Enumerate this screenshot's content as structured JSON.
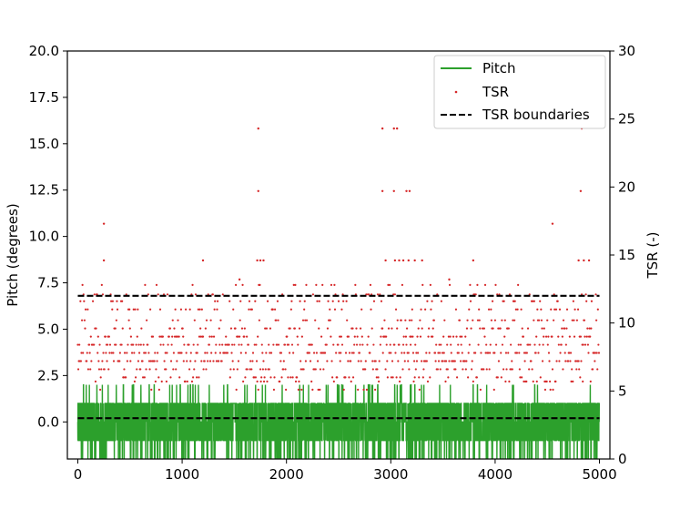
{
  "chart_data": {
    "type": "line",
    "title": "",
    "xlabel": "",
    "ylabel_left": "Pitch (degrees)",
    "ylabel_right": "TSR (-)",
    "xlim": [
      -100,
      5100
    ],
    "ylim_left": [
      -2,
      20
    ],
    "ylim_right": [
      0,
      30
    ],
    "x_ticks": [
      0,
      1000,
      2000,
      3000,
      4000,
      5000
    ],
    "x_tick_labels": [
      "0",
      "1000",
      "2000",
      "3000",
      "4000",
      "5000"
    ],
    "y_left_ticks": [
      0,
      2.5,
      5,
      7.5,
      10,
      12.5,
      15,
      17.5,
      20
    ],
    "y_left_tick_labels": [
      "0.0",
      "2.5",
      "5.0",
      "7.5",
      "10.0",
      "12.5",
      "15.0",
      "17.5",
      "20.0"
    ],
    "y_right_ticks": [
      0,
      5,
      10,
      15,
      20,
      25,
      30
    ],
    "y_right_tick_labels": [
      "0",
      "5",
      "10",
      "15",
      "20",
      "25",
      "30"
    ],
    "grid": false,
    "legend_position": "top-right",
    "colors": {
      "pitch": "#2ca02c",
      "tsr": "#d62728",
      "boundaries": "#000000"
    },
    "series": [
      {
        "name": "Pitch",
        "axis": "left",
        "style": "line",
        "x_range": [
          0,
          5000
        ],
        "levels": [
          -2,
          -1,
          0,
          1,
          2
        ],
        "level_weights": [
          0.08,
          0.32,
          0.2,
          0.38,
          0.02
        ],
        "dominant_levels": [
          -1,
          1
        ]
      },
      {
        "name": "TSR",
        "axis": "right",
        "style": "points",
        "x_range": [
          0,
          5000
        ],
        "levels": [
          5.1,
          5.7,
          6.0,
          6.6,
          7.2,
          7.8,
          8.4,
          9.0,
          9.6,
          10.2,
          11.0,
          11.6,
          12.1,
          12.8
        ],
        "level_weights": [
          0.02,
          0.04,
          0.07,
          0.09,
          0.12,
          0.13,
          0.12,
          0.1,
          0.08,
          0.07,
          0.06,
          0.04,
          0.04,
          0.02
        ],
        "outliers": [
          {
            "x": 250,
            "y": 17.3
          },
          {
            "x": 250,
            "y": 14.6
          },
          {
            "x": 1200,
            "y": 14.6
          },
          {
            "x": 1550,
            "y": 13.2
          },
          {
            "x": 1730,
            "y": 24.3
          },
          {
            "x": 1730,
            "y": 19.7
          },
          {
            "x": 1720,
            "y": 14.6
          },
          {
            "x": 1750,
            "y": 14.6
          },
          {
            "x": 1780,
            "y": 14.6
          },
          {
            "x": 2920,
            "y": 24.3
          },
          {
            "x": 3030,
            "y": 24.3
          },
          {
            "x": 3060,
            "y": 24.3
          },
          {
            "x": 2920,
            "y": 19.7
          },
          {
            "x": 3030,
            "y": 19.7
          },
          {
            "x": 3150,
            "y": 19.7
          },
          {
            "x": 3180,
            "y": 19.7
          },
          {
            "x": 2950,
            "y": 14.6
          },
          {
            "x": 3040,
            "y": 14.6
          },
          {
            "x": 3080,
            "y": 14.6
          },
          {
            "x": 3120,
            "y": 14.6
          },
          {
            "x": 3170,
            "y": 14.6
          },
          {
            "x": 3230,
            "y": 14.6
          },
          {
            "x": 3300,
            "y": 14.6
          },
          {
            "x": 3560,
            "y": 13.2
          },
          {
            "x": 3790,
            "y": 14.6
          },
          {
            "x": 4550,
            "y": 17.3
          },
          {
            "x": 4820,
            "y": 19.7
          },
          {
            "x": 4830,
            "y": 24.3
          },
          {
            "x": 4800,
            "y": 14.6
          },
          {
            "x": 4850,
            "y": 14.6
          },
          {
            "x": 4900,
            "y": 14.6
          }
        ]
      },
      {
        "name": "TSR boundaries",
        "axis": "right",
        "style": "dashed",
        "lines": [
          {
            "x": [
              0,
              5000
            ],
            "y": [
              12.0,
              12.0
            ]
          },
          {
            "x": [
              0,
              5000
            ],
            "y": [
              3.0,
              3.0
            ]
          }
        ]
      }
    ]
  }
}
